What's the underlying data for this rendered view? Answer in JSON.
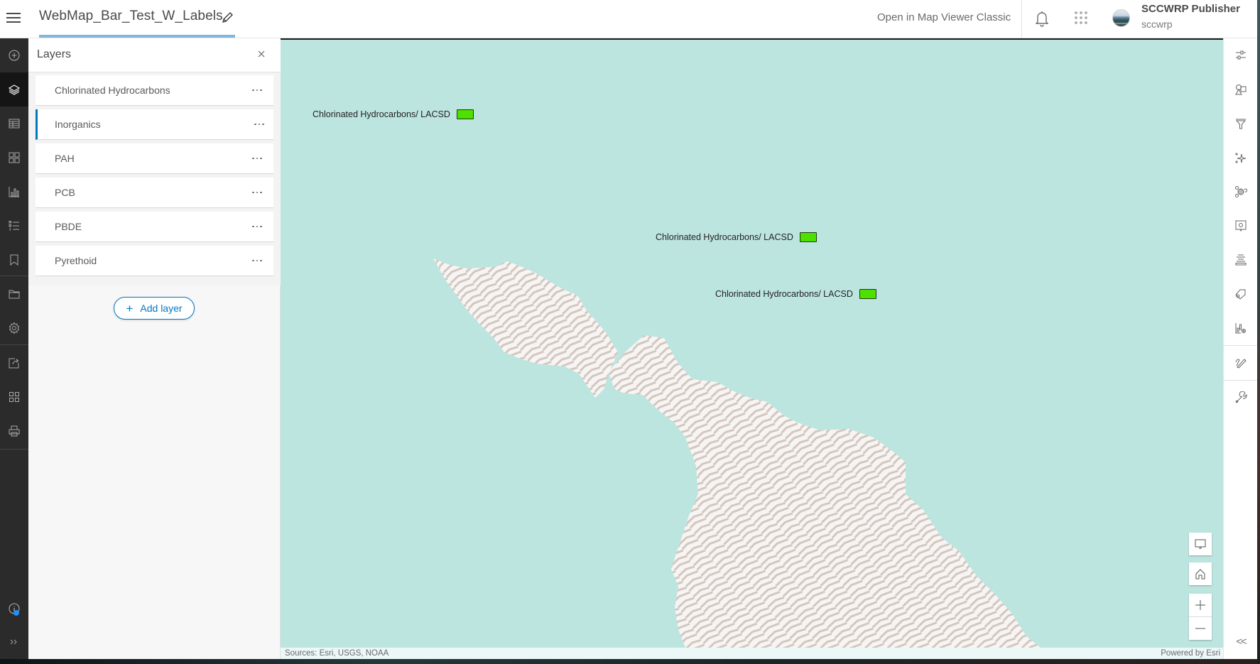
{
  "header": {
    "title": "WebMap_Bar_Test_W_Labels",
    "open_classic_label": "Open in Map Viewer Classic",
    "user_name": "SCCWRP Publisher",
    "user_handle": "sccwrp",
    "icons": [
      "menu-icon",
      "edit-icon",
      "bell-icon",
      "apps-grid-icon",
      "avatar"
    ]
  },
  "left_rail": {
    "items": [
      {
        "name": "add",
        "icon": "add-circle-icon",
        "active": false
      },
      {
        "name": "layers",
        "icon": "layers-icon",
        "active": true
      },
      {
        "name": "tables",
        "icon": "table-icon",
        "active": false
      },
      {
        "name": "basemap",
        "icon": "basemap-gallery-icon",
        "active": false
      },
      {
        "name": "charts",
        "icon": "bar-chart-icon",
        "active": false
      },
      {
        "name": "legend",
        "icon": "legend-icon",
        "active": false
      },
      {
        "name": "bookmarks",
        "icon": "bookmark-icon",
        "active": false
      },
      {
        "name": "save-open",
        "icon": "folder-icon",
        "active": false
      },
      {
        "name": "map-properties",
        "icon": "gear-icon",
        "active": false
      },
      {
        "name": "share",
        "icon": "share-icon",
        "active": false
      },
      {
        "name": "create-app",
        "icon": "apps-icon",
        "active": false
      },
      {
        "name": "print",
        "icon": "print-icon",
        "active": false
      },
      {
        "name": "whats-new",
        "icon": "info-icon",
        "active": false
      },
      {
        "name": "expand",
        "icon": "expand-icon",
        "active": false
      }
    ]
  },
  "layers_panel": {
    "title": "Layers",
    "layers": [
      {
        "name": "Chlorinated Hydrocarbons",
        "selected": false
      },
      {
        "name": "Inorganics",
        "selected": true
      },
      {
        "name": "PAH",
        "selected": false
      },
      {
        "name": "PCB",
        "selected": false
      },
      {
        "name": "PBDE",
        "selected": false
      },
      {
        "name": "Pyrethoid",
        "selected": false
      }
    ],
    "add_layer_label": "Add layer",
    "add_layer_icon": "+"
  },
  "map": {
    "labels": [
      {
        "text": "Chlorinated Hydrocarbons/ LACSD",
        "swatch_color": "#4ee000"
      },
      {
        "text": "Chlorinated Hydrocarbons/ LACSD",
        "swatch_color": "#4ee000"
      },
      {
        "text": "Chlorinated Hydrocarbons/ LACSD",
        "swatch_color": "#4ee000"
      }
    ],
    "attribution_left": "Sources: Esri, USGS, NOAA",
    "attribution_right": "Powered by Esri",
    "ocean_color": "#bde5e0",
    "controls": [
      "full-screen-icon",
      "home-icon",
      "zoom-in-icon",
      "zoom-out-icon"
    ]
  },
  "right_toolbar": {
    "items": [
      "properties-icon",
      "styles-icon",
      "filter-icon",
      "effects-icon",
      "clustering-icon",
      "popups-icon",
      "fields-icon",
      "labels-icon",
      "configure-charts-icon",
      "sketch-icon",
      "measure-icon"
    ],
    "collapse_label": "<<"
  },
  "colors": {
    "accent": "#0079c1",
    "rail_bg": "#2b2b2b",
    "swatch": "#4ee000"
  }
}
